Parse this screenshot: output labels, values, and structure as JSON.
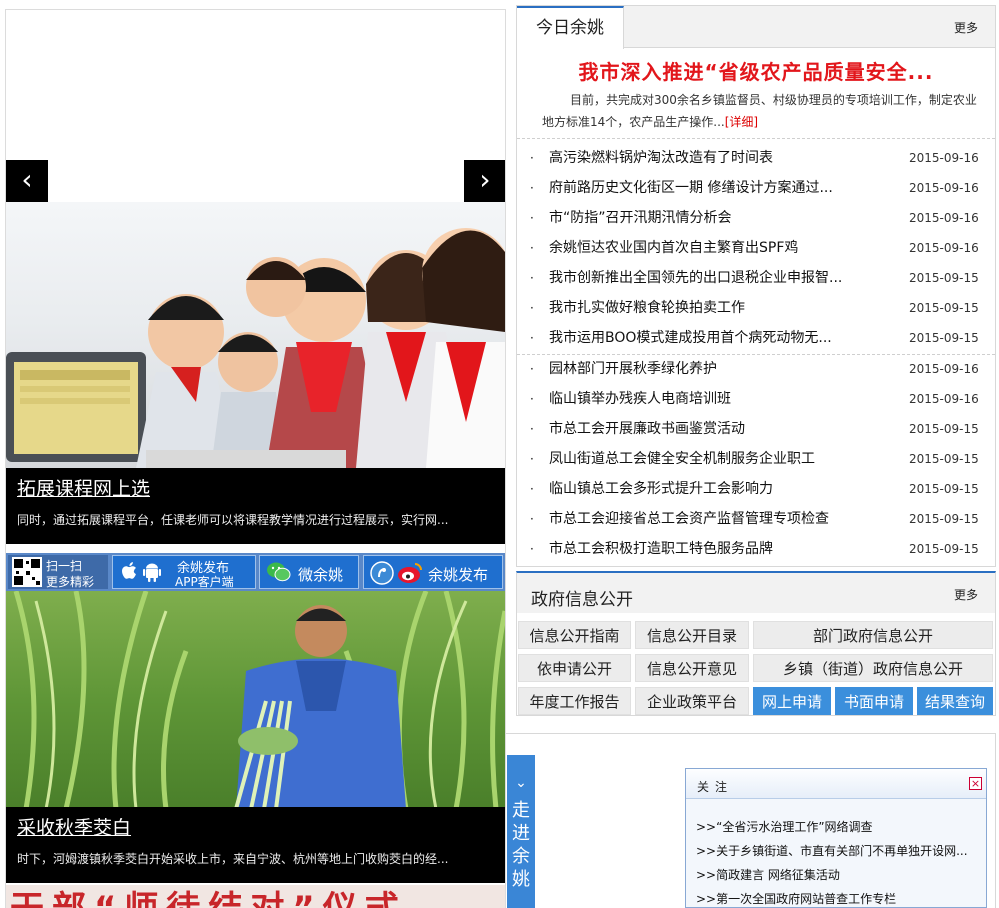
{
  "slideshow": {
    "slide1": {
      "title": "拓展课程网上选",
      "desc": "同时，通过拓展课程平台，任课老师可以将课程教学情况进行过程展示，实行网..."
    },
    "slide2": {
      "title": "采收秋季茭白",
      "desc": "时下，河姆渡镇秋季茭白开始采收上市，来自宁波、杭州等地上门收购茭白的经..."
    },
    "slide3_partial_text": "干部“师徒结对”仪式",
    "prev_icon": "‹",
    "next_icon": "›"
  },
  "promo": {
    "qr_line1": "扫一扫",
    "qr_line2": "更多精彩",
    "app_line1": "余姚发布",
    "app_line2": "APP客户端",
    "wechat": "微余姚",
    "weibo": "余姚发布"
  },
  "news": {
    "tab": "今日余姚",
    "more": "更多",
    "headline": "我市深入推进“省级农产品质量安全...",
    "summary": "目前，共完成对300余名乡镇监督员、村级协理员的专项培训工作，制定农业地方标准14个，农产品生产操作...",
    "detail_link": "[详细]",
    "group1": [
      {
        "title": "高污染燃料锅炉淘汰改造有了时间表",
        "date": "2015-09-16"
      },
      {
        "title": "府前路历史文化街区一期 修缮设计方案通过...",
        "date": "2015-09-16"
      },
      {
        "title": "市“防指”召开汛期汛情分析会",
        "date": "2015-09-16"
      },
      {
        "title": "余姚恒达农业国内首次自主繁育出SPF鸡",
        "date": "2015-09-16"
      },
      {
        "title": "我市创新推出全国领先的出口退税企业申报智...",
        "date": "2015-09-15"
      },
      {
        "title": "我市扎实做好粮食轮换拍卖工作",
        "date": "2015-09-15"
      },
      {
        "title": "我市运用BOO模式建成投用首个病死动物无...",
        "date": "2015-09-15"
      }
    ],
    "group2": [
      {
        "title": "园林部门开展秋季绿化养护",
        "date": "2015-09-16"
      },
      {
        "title": "临山镇举办残疾人电商培训班",
        "date": "2015-09-16"
      },
      {
        "title": "市总工会开展廉政书画鉴赏活动",
        "date": "2015-09-15"
      },
      {
        "title": "凤山街道总工会健全安全机制服务企业职工",
        "date": "2015-09-15"
      },
      {
        "title": "临山镇总工会多形式提升工会影响力",
        "date": "2015-09-15"
      },
      {
        "title": "市总工会迎接省总工会资产监督管理专项检查",
        "date": "2015-09-15"
      },
      {
        "title": "市总工会积极打造职工特色服务品牌",
        "date": "2015-09-15"
      }
    ],
    "bullet": "·"
  },
  "gov": {
    "title": "政府信息公开",
    "more": "更多",
    "buttons": {
      "guide": "信息公开指南",
      "catalog": "信息公开目录",
      "dept": "部门政府信息公开",
      "apply": "依申请公开",
      "opinion": "信息公开意见",
      "township": "乡镇（街道）政府信息公开",
      "annual": "年度工作报告",
      "enterprise": "企业政策平台",
      "online": "网上申请",
      "written": "书面申请",
      "result": "结果查询"
    }
  },
  "walk": {
    "chevron": "⌄",
    "text": "走进余姚"
  },
  "popup": {
    "title": "关注",
    "close": "×",
    "items": [
      ">>“全省污水治理工作”网络调查",
      ">>关于乡镇街道、市直有关部门不再单独开设网...",
      ">>简政建言 网络征集活动",
      ">>第一次全国政府网站普查工作专栏"
    ]
  },
  "colors": {
    "accent_blue": "#2a6fc2",
    "headline_red": "#e2161b",
    "button_blue": "#3b8fdc"
  }
}
